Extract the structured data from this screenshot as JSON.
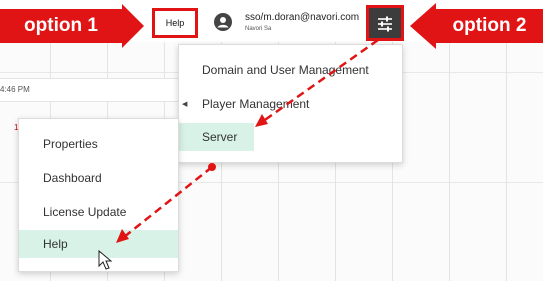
{
  "annotations": {
    "option1": "option 1",
    "option2": "option 2"
  },
  "header": {
    "help_label": "Help",
    "user_email": "sso/m.doran@navori.com",
    "user_org": "Navori Sa",
    "settings_icon": "sliders-icon"
  },
  "background": {
    "time_text": "4:46 PM"
  },
  "admin_menu": {
    "items": [
      {
        "label": "Domain and User Management"
      },
      {
        "label": "Player Management"
      },
      {
        "label": "Server"
      }
    ]
  },
  "settings_menu": {
    "items": [
      {
        "label": "Properties"
      },
      {
        "label": "Dashboard"
      },
      {
        "label": "License Update"
      },
      {
        "label": "Help"
      }
    ]
  },
  "colors": {
    "annotation_red": "#e01414",
    "highlight": "#d8f2e8",
    "settings_button": "#3c3c3c"
  }
}
